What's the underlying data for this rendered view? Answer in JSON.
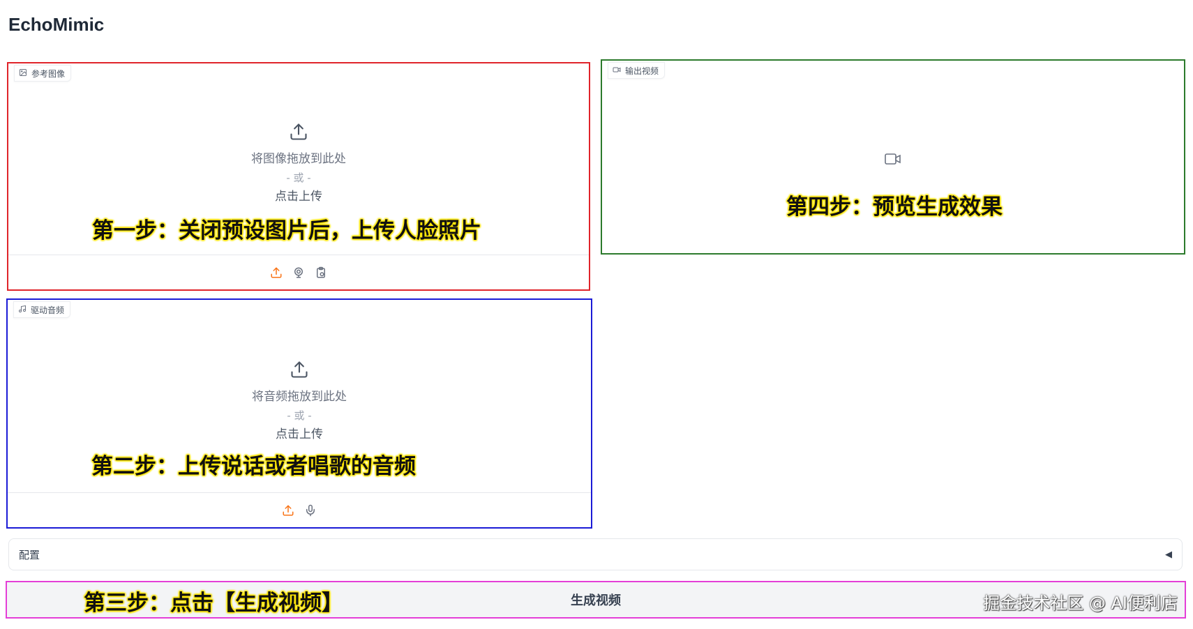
{
  "app": {
    "title": "EchoMimic"
  },
  "image_panel": {
    "label": "参考图像",
    "drop_text": "将图像拖放到此处",
    "or_text": "- 或 -",
    "click_text": "点击上传",
    "annotation": "第一步：关闭预设图片后，上传人脸照片",
    "border_color": "#e0242a"
  },
  "audio_panel": {
    "label": "驱动音频",
    "drop_text": "将音频拖放到此处",
    "or_text": "- 或 -",
    "click_text": "点击上传",
    "annotation": "第二步：上传说话或者唱歌的音频",
    "border_color": "#1b1bd6"
  },
  "video_panel": {
    "label": "输出视频",
    "annotation": "第四步：预览生成效果",
    "border_color": "#2c7a2c"
  },
  "config": {
    "label": "配置",
    "arrow": "◀"
  },
  "generate": {
    "label": "生成视频",
    "annotation": "第三步：点击【生成视频】",
    "border_color": "#e43ed7"
  },
  "watermark": "掘金技术社区 @ AI便利店",
  "icons": {
    "image": "image-icon",
    "upload": "upload-icon",
    "webcam": "webcam-icon",
    "clipboard": "clipboard-icon",
    "music": "music-icon",
    "microphone": "microphone-icon",
    "video": "video-icon"
  },
  "colors": {
    "accent": "#f97316",
    "annotation_glow": "#ffe600"
  }
}
